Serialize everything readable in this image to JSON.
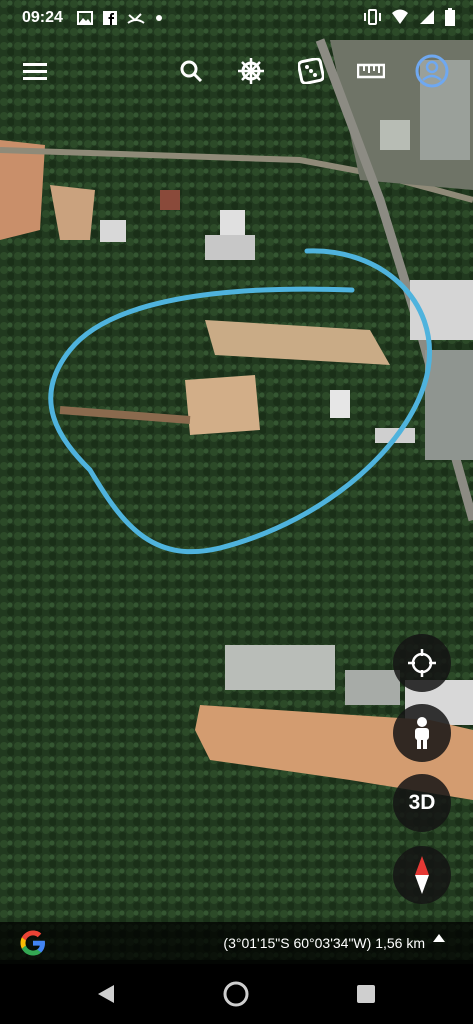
{
  "status": {
    "time": "09:24"
  },
  "toolbar": {
    "menu": "menu-icon",
    "search": "search-icon",
    "voyager": "ship-wheel-icon",
    "feeling_lucky": "dice-icon",
    "measure": "ruler-icon",
    "account": "account-icon"
  },
  "controls": {
    "three_d": "3D"
  },
  "footer": {
    "coords": "(3°01'15\"S 60°03'34\"W) 1,56 km"
  },
  "colors": {
    "annotation": "#4fb3dd",
    "forest": "#1f3a1e",
    "clearing": "#c9a47a"
  }
}
